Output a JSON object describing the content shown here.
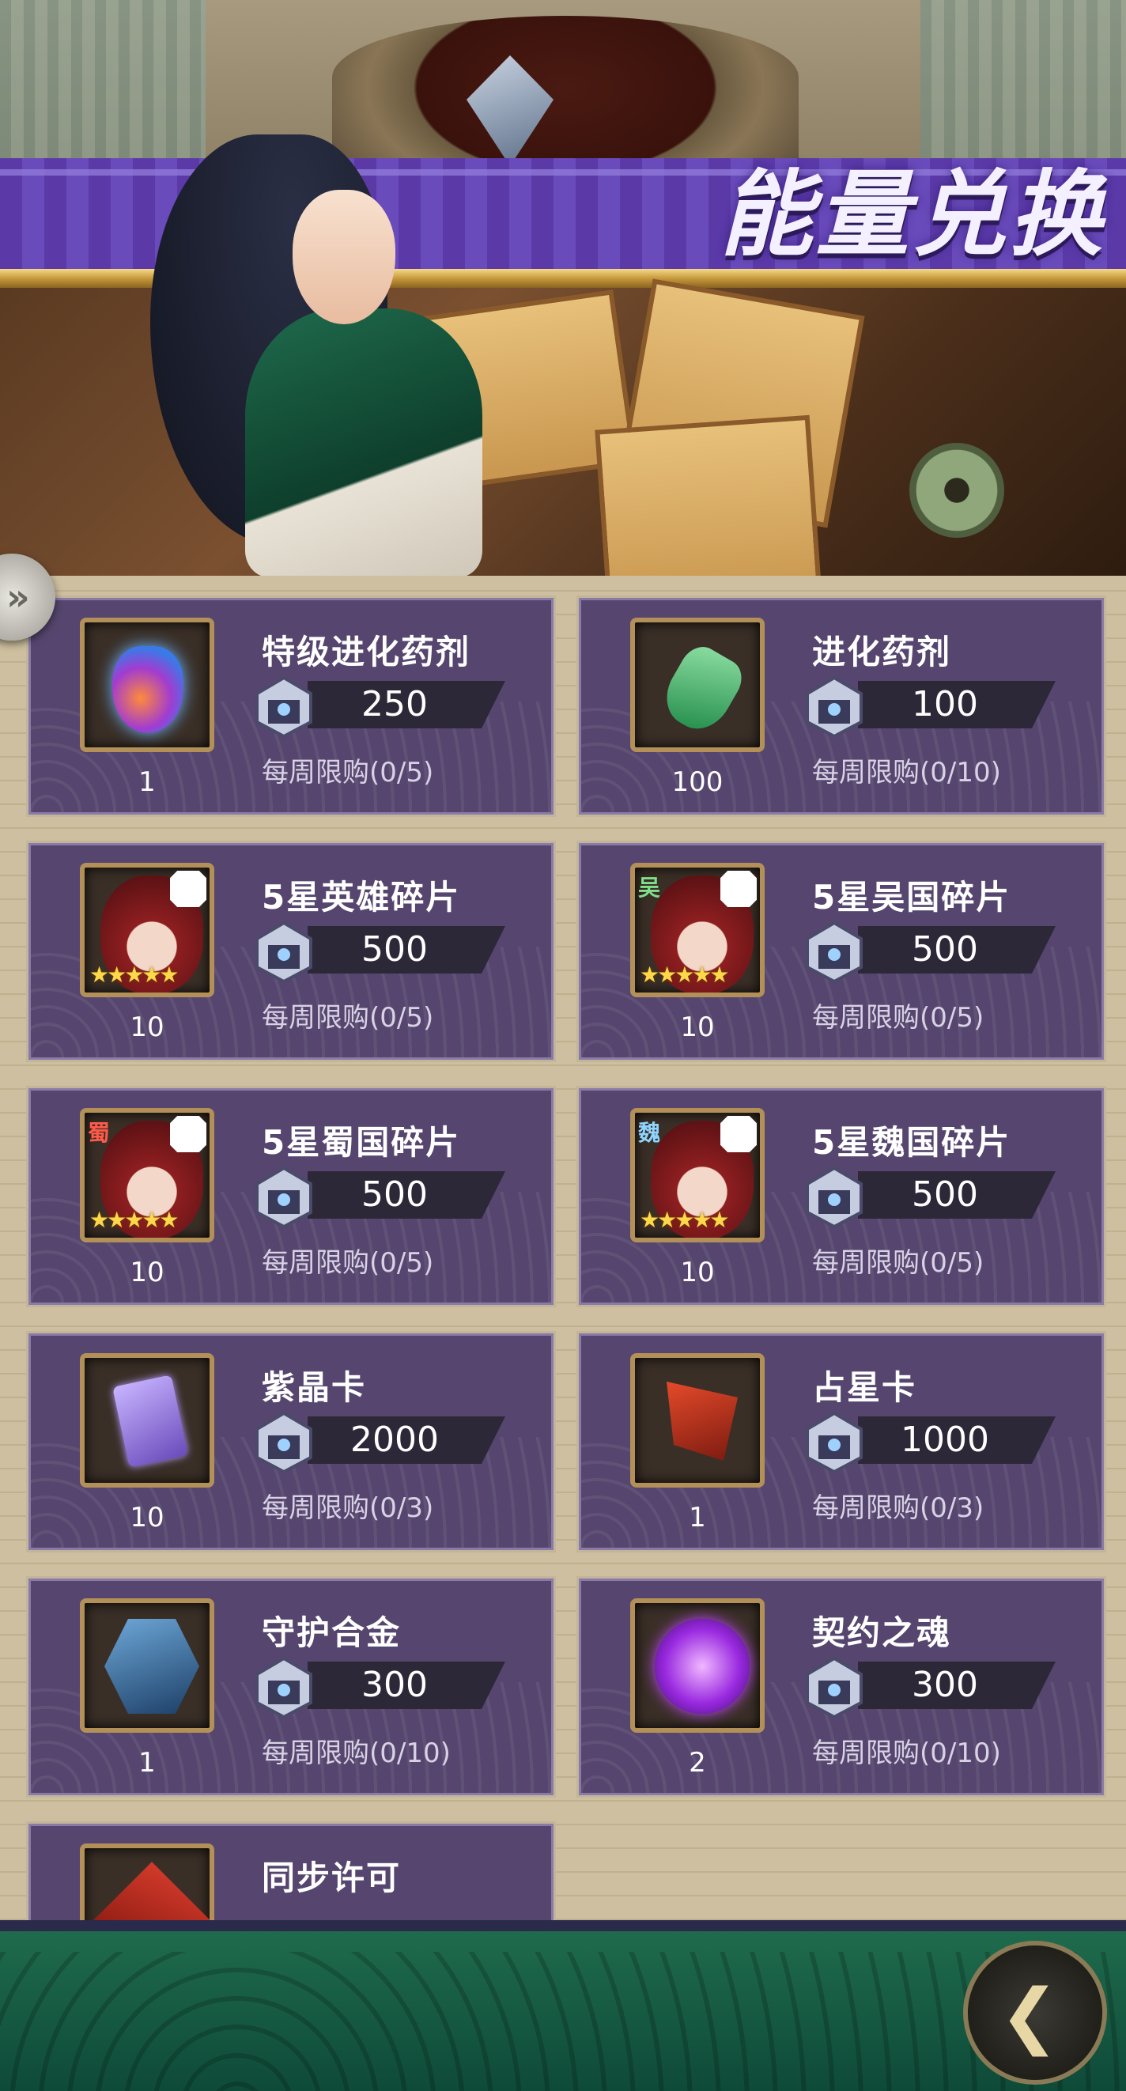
{
  "banner": {
    "title": "能量兑换"
  },
  "items": [
    {
      "name": "特级进化药剂",
      "price": "250",
      "limit": "每周限购(0/5)",
      "qty": "1",
      "icon": "super-evolution-potion-icon"
    },
    {
      "name": "进化药剂",
      "price": "100",
      "limit": "每周限购(0/10)",
      "qty": "100",
      "icon": "evolution-potion-icon"
    },
    {
      "name": "5星英雄碎片",
      "price": "500",
      "limit": "每周限购(0/5)",
      "qty": "10",
      "icon": "hero-shard-icon",
      "stars": "★★★★★"
    },
    {
      "name": "5星吴国碎片",
      "price": "500",
      "limit": "每周限购(0/5)",
      "qty": "10",
      "icon": "wu-shard-icon",
      "stars": "★★★★★",
      "faction": "吴"
    },
    {
      "name": "5星蜀国碎片",
      "price": "500",
      "limit": "每周限购(0/5)",
      "qty": "10",
      "icon": "shu-shard-icon",
      "stars": "★★★★★",
      "faction": "蜀"
    },
    {
      "name": "5星魏国碎片",
      "price": "500",
      "limit": "每周限购(0/5)",
      "qty": "10",
      "icon": "wei-shard-icon",
      "stars": "★★★★★",
      "faction": "魏"
    },
    {
      "name": "紫晶卡",
      "price": "2000",
      "limit": "每周限购(0/3)",
      "qty": "10",
      "icon": "amethyst-card-icon"
    },
    {
      "name": "占星卡",
      "price": "1000",
      "limit": "每周限购(0/3)",
      "qty": "1",
      "icon": "astrology-card-icon"
    },
    {
      "name": "守护合金",
      "price": "300",
      "limit": "每周限购(0/10)",
      "qty": "1",
      "icon": "guardian-alloy-icon"
    },
    {
      "name": "契约之魂",
      "price": "300",
      "limit": "每周限购(0/10)",
      "qty": "2",
      "icon": "contract-soul-icon"
    },
    {
      "name": "同步许可",
      "price": "",
      "limit": "",
      "qty": "",
      "icon": "sync-permit-icon"
    }
  ],
  "currency_icon": "energy-chest-icon",
  "colors": {
    "panel": "#56466f",
    "accent_purple": "#6a4bbb",
    "gold": "#c79a3c"
  },
  "nav": {
    "back_icon": "back-chevron-icon",
    "side_tab_icon": "double-chevron-right-icon",
    "side_tab_glyph": "»"
  }
}
